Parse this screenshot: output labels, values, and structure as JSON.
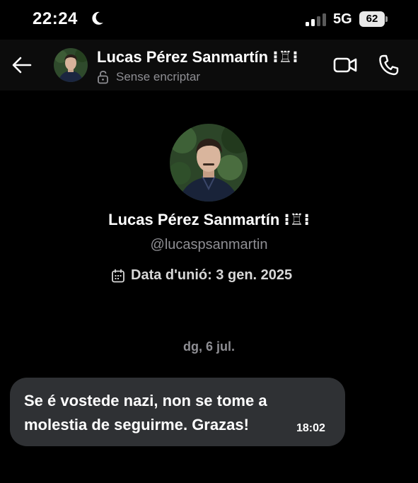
{
  "status_bar": {
    "time": "22:24",
    "network": "5G",
    "battery": "62"
  },
  "header": {
    "name": "Lucas Pérez Sanmartín ⁝♖⁝",
    "subtitle": "Sense encriptar"
  },
  "profile": {
    "name": "Lucas Pérez Sanmartín ⁝♖⁝",
    "handle": "@lucaspsanmartin",
    "joined": "Data d'unió: 3 gen. 2025"
  },
  "conversation": {
    "date_separator": "dg, 6 jul.",
    "messages": [
      {
        "text": "Se é vostede nazi, non se tome a molestia de seguirme. Grazas!",
        "time": "18:02"
      }
    ]
  },
  "colors": {
    "background": "#000000",
    "header_bg": "#0c0c0c",
    "bubble_bg": "#2f3134",
    "muted_text": "#8e8e93"
  }
}
